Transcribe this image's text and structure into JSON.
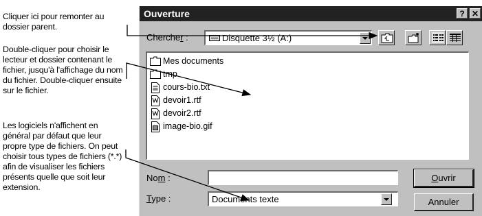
{
  "annotations": {
    "note1": "Cliquer ici pour remonter au dossier parent.",
    "note2": "Double-cliquer pour choisir le lecteur et dossier contenant le fichier, jusqu'à l'affichage du nom du fichier. Double-cliquer ensuite sur le fichier.",
    "note3": "Les logiciels n'affichent en général par défaut que leur propre type de fichiers. On peut choisir tous types de fichiers (*.*) afin de visualiser les fichiers présents quelle que soit leur extension."
  },
  "dialog": {
    "title": "Ouverture",
    "help_label": "?",
    "close_label": "✕",
    "look_in_label_pre": "Cherche",
    "look_in_label_ul": "r",
    "look_in_label_post": " :",
    "look_in_value": "Disquette 3½ (A:)",
    "files": [
      {
        "name": "Mes documents",
        "kind": "folder-icon"
      },
      {
        "name": "tmp",
        "kind": "folder-icon"
      },
      {
        "name": "cours-bio.txt",
        "kind": "text-file-icon"
      },
      {
        "name": "devoir1.rtf",
        "kind": "wordpad-file-icon"
      },
      {
        "name": "devoir2.rtf",
        "kind": "wordpad-file-icon"
      },
      {
        "name": "image-bio.gif",
        "kind": "image-file-icon"
      }
    ],
    "name_label_pre": "No",
    "name_label_ul": "m",
    "name_label_post": " :",
    "name_value": "",
    "type_label_ul": "T",
    "type_label_post": "ype :",
    "type_value": "Documents texte",
    "open_button_ul": "O",
    "open_button_post": "uvrir",
    "cancel_button": "Annuler"
  }
}
